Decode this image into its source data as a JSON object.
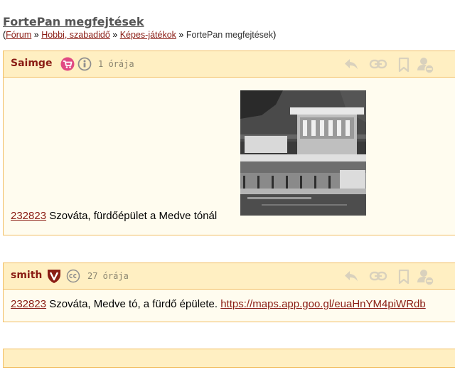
{
  "page": {
    "title": "FortePan megfejtések",
    "breadcrumb": {
      "open": "(",
      "items": [
        "Fórum",
        "Hobbi, szabadidő",
        "Képes-játékok"
      ],
      "sep": " » ",
      "current": "FortePan megfejtések",
      "close": ")"
    }
  },
  "posts": [
    {
      "author": "Saimge",
      "time": "1 órája",
      "link_text": "232823",
      "text": " Szováta, fürdőépület a Medve tónál"
    },
    {
      "author": "smith",
      "time": "27 órája",
      "link_text": "232823",
      "text": " Szováta, Medve tó, a fürdő épülete. ",
      "url": "https://maps.app.goo.gl/euaHnYM4piWRdb"
    }
  ],
  "colors": {
    "accent": "#8a1c14",
    "header_bg": "#ffefc2",
    "border": "#f2be62",
    "body_bg": "#fffcef",
    "icon_gray": "#d9d1bd"
  },
  "icons": [
    "cart-badge-icon",
    "info-icon",
    "v-shield-icon",
    "cc-icon",
    "reply-icon",
    "link-icon",
    "bookmark-icon",
    "user-block-icon"
  ]
}
